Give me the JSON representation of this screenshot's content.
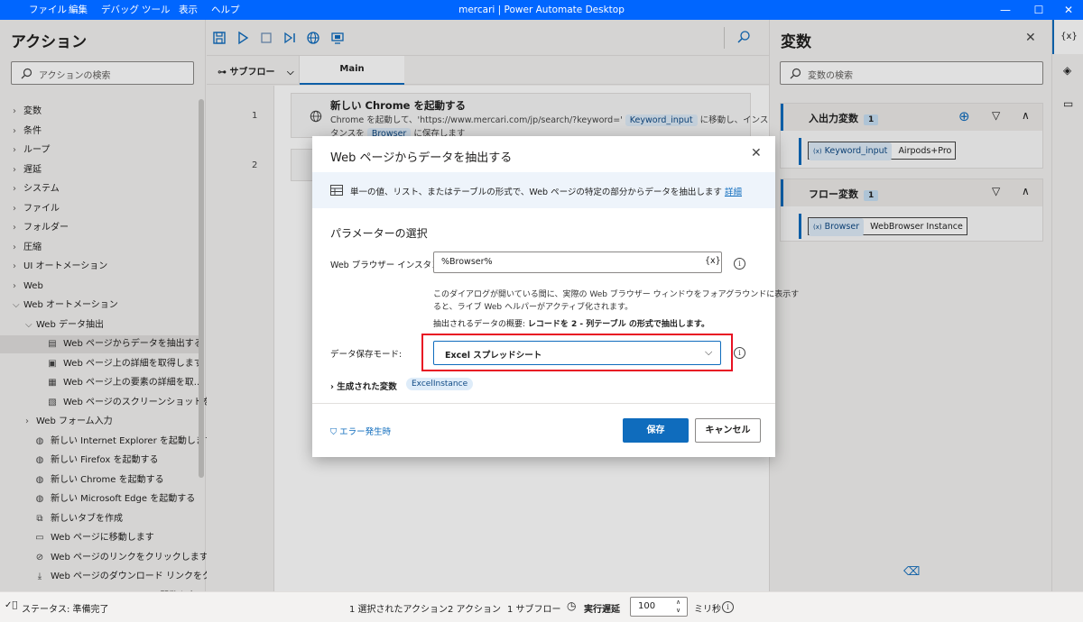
{
  "titlebar": {
    "menus": [
      "ファイル",
      "編集",
      "デバッグ",
      "ツール",
      "表示",
      "ヘルプ"
    ],
    "title": "mercari | Power Automate Desktop"
  },
  "actions": {
    "title": "アクション",
    "search_placeholder": "アクションの検索",
    "categories": [
      "変数",
      "条件",
      "ループ",
      "遅延",
      "システム",
      "ファイル",
      "フォルダー",
      "圧縮",
      "UI オートメーション",
      "Web",
      "Web オートメーション"
    ],
    "sub_extract": "Web データ抽出",
    "extract_items": [
      "Web ページからデータを抽出する",
      "Web ページ上の詳細を取得します",
      "Web ページ上の要素の詳細を取...",
      "Web ページのスクリーンショットを..."
    ],
    "sub_form": "Web フォーム入力",
    "form_items": [
      "新しい Internet Explorer を起動します",
      "新しい Firefox を起動する",
      "新しい Chrome を起動する",
      "新しい Microsoft Edge を起動する",
      "新しいタブを作成",
      "Web ページに移動します",
      "Web ページのリンクをクリックします",
      "Web ページのダウンロード リンクをクリ...",
      "Web ページで JavaScript 関数を実..."
    ]
  },
  "flow": {
    "subflow_label": "サブフロー",
    "main_tab": "Main",
    "line_numbers": [
      "1",
      "2"
    ],
    "step1": {
      "title": "新しい Chrome を起動する",
      "desc_a": "Chrome を起動して、'https://www.mercari.com/jp/search/?keyword=' ",
      "var1": "Keyword_input",
      "desc_b": " に移動し、インス",
      "desc_c": "タンスを ",
      "var2": "Browser",
      "desc_d": " に保存します"
    }
  },
  "variables": {
    "title": "変数",
    "search_placeholder": "変数の検索",
    "io_group": {
      "label": "入出力変数",
      "count": "1",
      "var_name": "Keyword_input",
      "var_value": "Airpods+Pro"
    },
    "flow_group": {
      "label": "フロー変数",
      "count": "1",
      "var_name": "Browser",
      "var_value": "WebBrowser Instance"
    },
    "var_prefix": "(x)"
  },
  "dialog": {
    "title": "Web ページからデータを抽出する",
    "info_text": "単一の値、リスト、またはテーブルの形式で、Web ページの特定の部分からデータを抽出します",
    "info_link": "詳細",
    "section": "パラメーターの選択",
    "browser_label": "Web ブラウザー インスタンス:",
    "browser_value": "%Browser%",
    "var_btn": "{x}",
    "help_1": "このダイアログが開いている間に、実際の Web ブラウザー ウィンドウをフォアグラウンドに表示す",
    "help_2": "ると、ライブ Web ヘルパーがアクティブ化されます。",
    "summary_prefix": "抽出されるデータの概要: ",
    "summary_bold": "レコードを 2 - 列テーブル の形式で抽出します。",
    "mode_label": "データ保存モード:",
    "mode_value": "Excel スプレッドシート",
    "generated_label": "生成された変数",
    "generated_var": "ExcelInstance",
    "error_link": "エラー発生時",
    "save": "保存",
    "cancel": "キャンセル",
    "highlight_color": "#e81123"
  },
  "status": {
    "text": "ステータス: 準備完了",
    "selected": "1 選択されたアクション",
    "actions": "2 アクション",
    "subflows": "1 サブフロー",
    "delay_label": "実行遅延",
    "delay_value": "100",
    "unit": "ミリ秒"
  },
  "colors": {
    "accent": "#0f6cbd",
    "titlebar": "#0066ff"
  }
}
